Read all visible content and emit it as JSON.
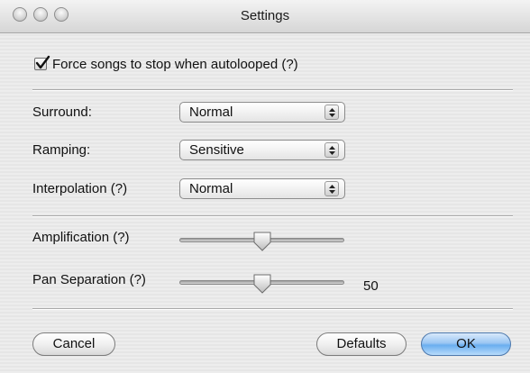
{
  "window": {
    "title": "Settings"
  },
  "force_stop": {
    "label": "Force songs to stop when autolooped (?)",
    "checked": true
  },
  "popups": [
    {
      "label": "Surround:",
      "value": "Normal"
    },
    {
      "label": "Ramping:",
      "value": "Sensitive"
    },
    {
      "label": "Interpolation (?)",
      "value": "Normal"
    }
  ],
  "sliders": [
    {
      "label": "Amplification (?)",
      "value_fraction": 0.5,
      "value_text": ""
    },
    {
      "label": "Pan Separation (?)",
      "value_fraction": 0.5,
      "value_text": "50"
    }
  ],
  "buttons": {
    "cancel": "Cancel",
    "defaults": "Defaults",
    "ok": "OK"
  }
}
